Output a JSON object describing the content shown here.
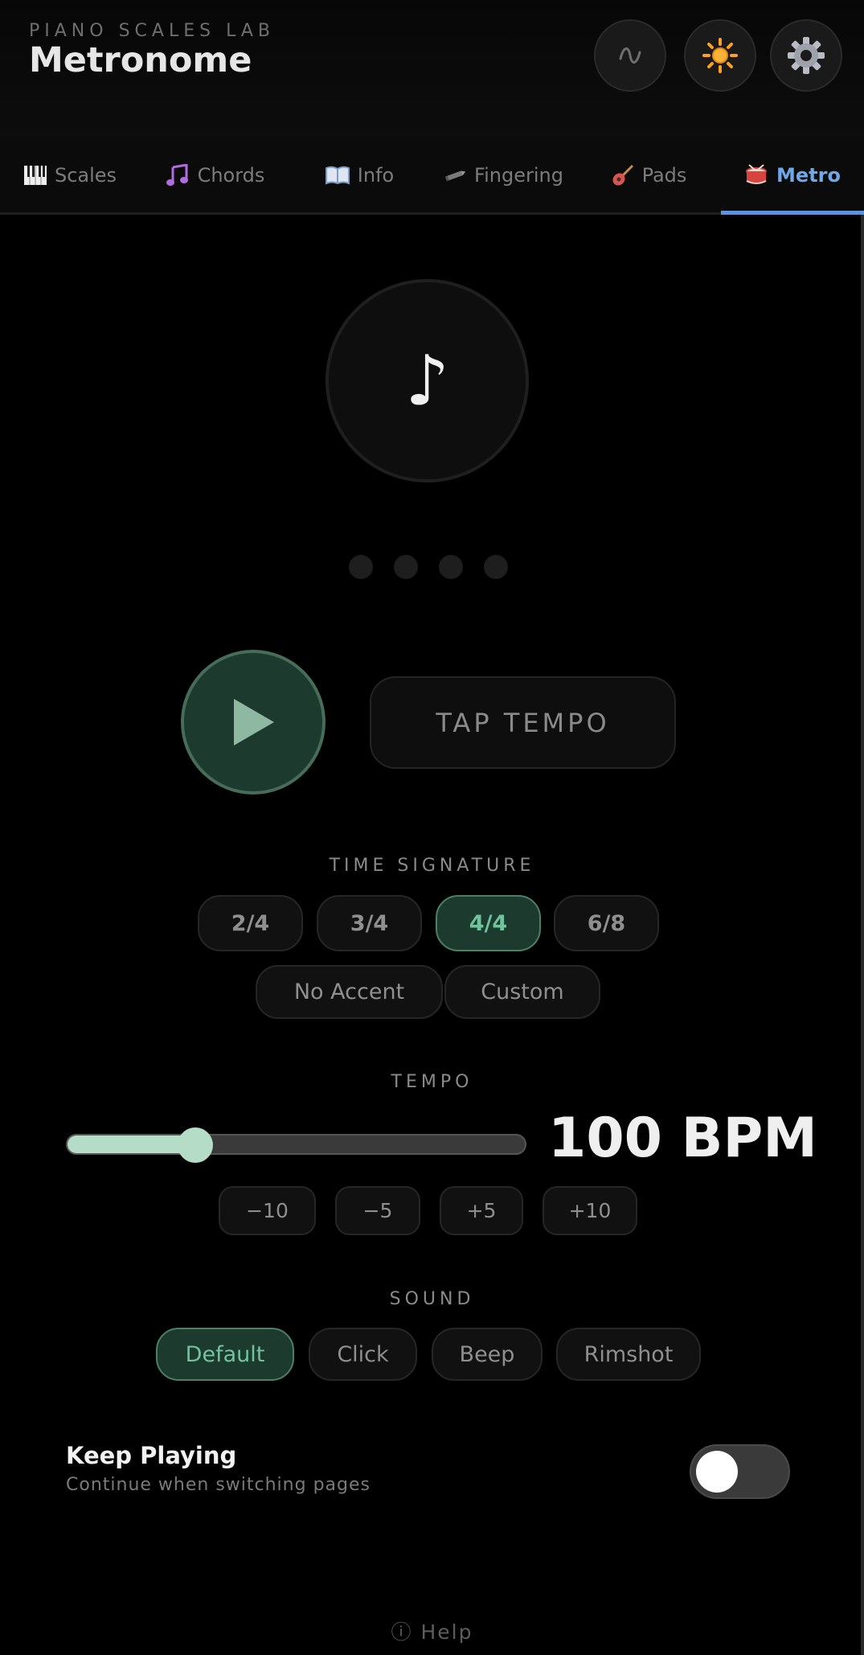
{
  "header": {
    "app_name": "PIANO SCALES LAB",
    "title": "Metronome",
    "buttons": [
      {
        "name": "waveform-button",
        "icon": "waveform-icon"
      },
      {
        "name": "theme-button",
        "icon": "sun-icon"
      },
      {
        "name": "settings-button",
        "icon": "gear-icon"
      }
    ]
  },
  "tabs": [
    {
      "label": "Scales",
      "icon": "piano-keys-icon"
    },
    {
      "label": "Chords",
      "icon": "music-notes-icon"
    },
    {
      "label": "Info",
      "icon": "open-book-icon"
    },
    {
      "label": "Fingering",
      "icon": "pencil-icon"
    },
    {
      "label": "Pads",
      "icon": "guitar-icon"
    },
    {
      "label": "Metro",
      "icon": "drum-icon",
      "active": true
    }
  ],
  "beat": {
    "symbol": "♪",
    "dots": 4
  },
  "controls": {
    "tap_tempo": "TAP TEMPO"
  },
  "time_signature": {
    "label": "TIME SIGNATURE",
    "options": [
      "2/4",
      "3/4",
      "4/4",
      "6/8"
    ],
    "selected": "4/4",
    "accent_options": [
      "No Accent",
      "Custom"
    ]
  },
  "tempo": {
    "label": "TEMPO",
    "value": 100,
    "bpm_text": "100 BPM",
    "slider_fraction": 0.28,
    "steps": [
      "−10",
      "−5",
      "+5",
      "+10"
    ]
  },
  "sound": {
    "label": "SOUND",
    "options": [
      "Default",
      "Click",
      "Beep",
      "Rimshot"
    ],
    "selected": "Default"
  },
  "keep_playing": {
    "title": "Keep Playing",
    "subtitle": "Continue when switching pages",
    "enabled": false
  },
  "help": {
    "icon": "info-circle-icon",
    "label": "ⓘ Help"
  },
  "colors": {
    "accent_green": "#6fc49d",
    "selected_bg": "#1d3a2e",
    "tab_active": "#6ea8e8",
    "slider": "#b4dcc6"
  }
}
